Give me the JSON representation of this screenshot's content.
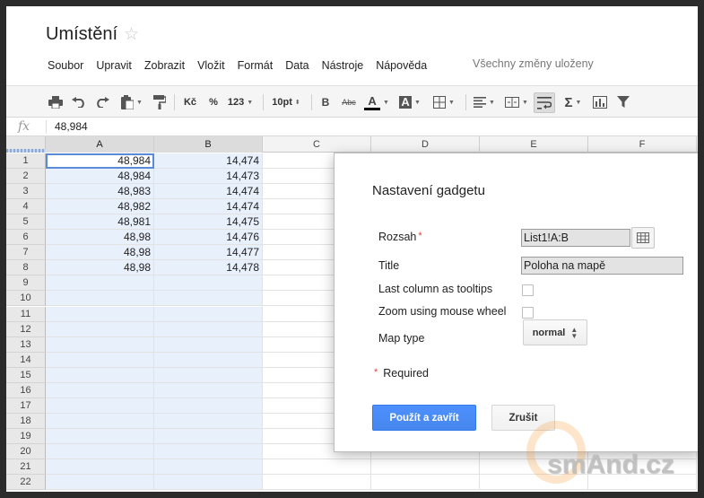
{
  "document": {
    "title": "Umístění",
    "star_glyph": "☆",
    "save_status": "Všechny změny uloženy"
  },
  "menu": [
    "Soubor",
    "Upravit",
    "Zobrazit",
    "Vložit",
    "Formát",
    "Data",
    "Nástroje",
    "Nápověda"
  ],
  "toolbar": {
    "currency": "Kč",
    "percent": "%",
    "number_format": "123",
    "font_size": "10pt",
    "bold": "B",
    "strikethrough": "Abc",
    "text_color": "A",
    "fill_color": "A",
    "sum": "Σ",
    "icons": [
      "print-icon",
      "undo-icon",
      "redo-icon",
      "paste-icon",
      "paint-format-icon",
      "borders-icon",
      "align-icon",
      "merge-icon",
      "wrap-text-icon",
      "sum-icon",
      "chart-icon",
      "filter-icon"
    ]
  },
  "formula_bar": {
    "fx": "fx",
    "value": "48,984"
  },
  "sheet": {
    "columns": [
      "A",
      "B",
      "C",
      "D",
      "E",
      "F"
    ],
    "rows": [
      {
        "n": "1",
        "a": "48,984",
        "b": "14,474"
      },
      {
        "n": "2",
        "a": "48,984",
        "b": "14,473"
      },
      {
        "n": "3",
        "a": "48,983",
        "b": "14,474"
      },
      {
        "n": "4",
        "a": "48,982",
        "b": "14,474"
      },
      {
        "n": "5",
        "a": "48,981",
        "b": "14,475"
      },
      {
        "n": "6",
        "a": "48,98",
        "b": "14,476"
      },
      {
        "n": "7",
        "a": "48,98",
        "b": "14,477"
      },
      {
        "n": "8",
        "a": "48,98",
        "b": "14,478"
      },
      {
        "n": "9",
        "a": "",
        "b": ""
      },
      {
        "n": "10",
        "a": "",
        "b": ""
      },
      {
        "n": "11",
        "a": "",
        "b": ""
      },
      {
        "n": "12",
        "a": "",
        "b": ""
      },
      {
        "n": "13",
        "a": "",
        "b": ""
      },
      {
        "n": "14",
        "a": "",
        "b": ""
      },
      {
        "n": "15",
        "a": "",
        "b": ""
      },
      {
        "n": "16",
        "a": "",
        "b": ""
      },
      {
        "n": "17",
        "a": "",
        "b": ""
      },
      {
        "n": "18",
        "a": "",
        "b": ""
      },
      {
        "n": "19",
        "a": "",
        "b": ""
      },
      {
        "n": "20",
        "a": "",
        "b": ""
      },
      {
        "n": "21",
        "a": "",
        "b": ""
      },
      {
        "n": "22",
        "a": "",
        "b": ""
      }
    ]
  },
  "dialog": {
    "title": "Nastavení gadgetu",
    "range_label": "Rozsah",
    "required_mark": "*",
    "range_value": "List1!A:B",
    "title_label": "Title",
    "title_value": "Poloha na mapě",
    "tooltips_label": "Last column as tooltips",
    "tooltips_checked": false,
    "zoom_label": "Zoom using mouse wheel",
    "zoom_checked": false,
    "map_type_label": "Map type",
    "map_type_value": "normal",
    "required_note": "Required",
    "apply_button": "Použít a zavřít",
    "cancel_button": "Zrušit"
  },
  "watermark": "smAnd.cz",
  "colors": {
    "selection_fill": "#e8f0fc",
    "active_outline": "#5a8bd8",
    "primary_button": "#4d90fe",
    "required_star": "#d14836"
  }
}
